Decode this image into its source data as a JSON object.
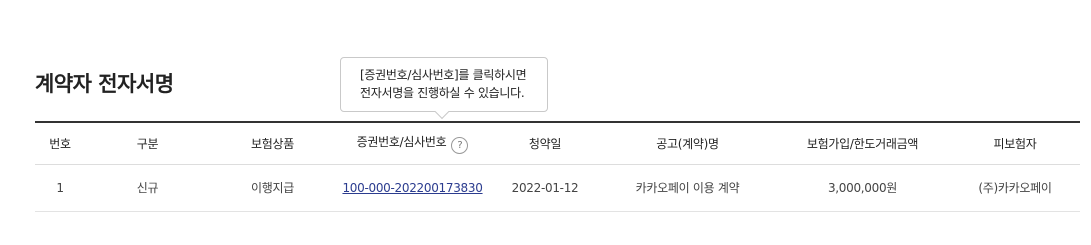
{
  "page": {
    "title": "계약자 전자서명"
  },
  "tooltip": {
    "line1": "[증권번호/심사번호]를 클릭하시면",
    "line2": "전자서명을 진행하실 수 있습니다."
  },
  "table": {
    "headers": {
      "no": "번호",
      "type": "구분",
      "product": "보험상품",
      "policy": "증권번호/심사번호",
      "date": "청약일",
      "notice": "공고(계약)명",
      "amount": "보험가입/한도거래금액",
      "insured": "피보험자"
    },
    "help_icon_glyph": "?",
    "rows": [
      {
        "no": "1",
        "type": "신규",
        "product": "이행지급",
        "policy": "100-000-202200173830",
        "date": "2022-01-12",
        "notice": "카카오페이 이용 계약",
        "amount": "3,000,000원",
        "insured": "(주)카카오페이"
      }
    ]
  },
  "icons": {
    "help": "help-circle-icon"
  },
  "colors": {
    "link": "#2b3c8f",
    "header_border": "#333333",
    "tooltip_border": "#c9c9c9"
  }
}
